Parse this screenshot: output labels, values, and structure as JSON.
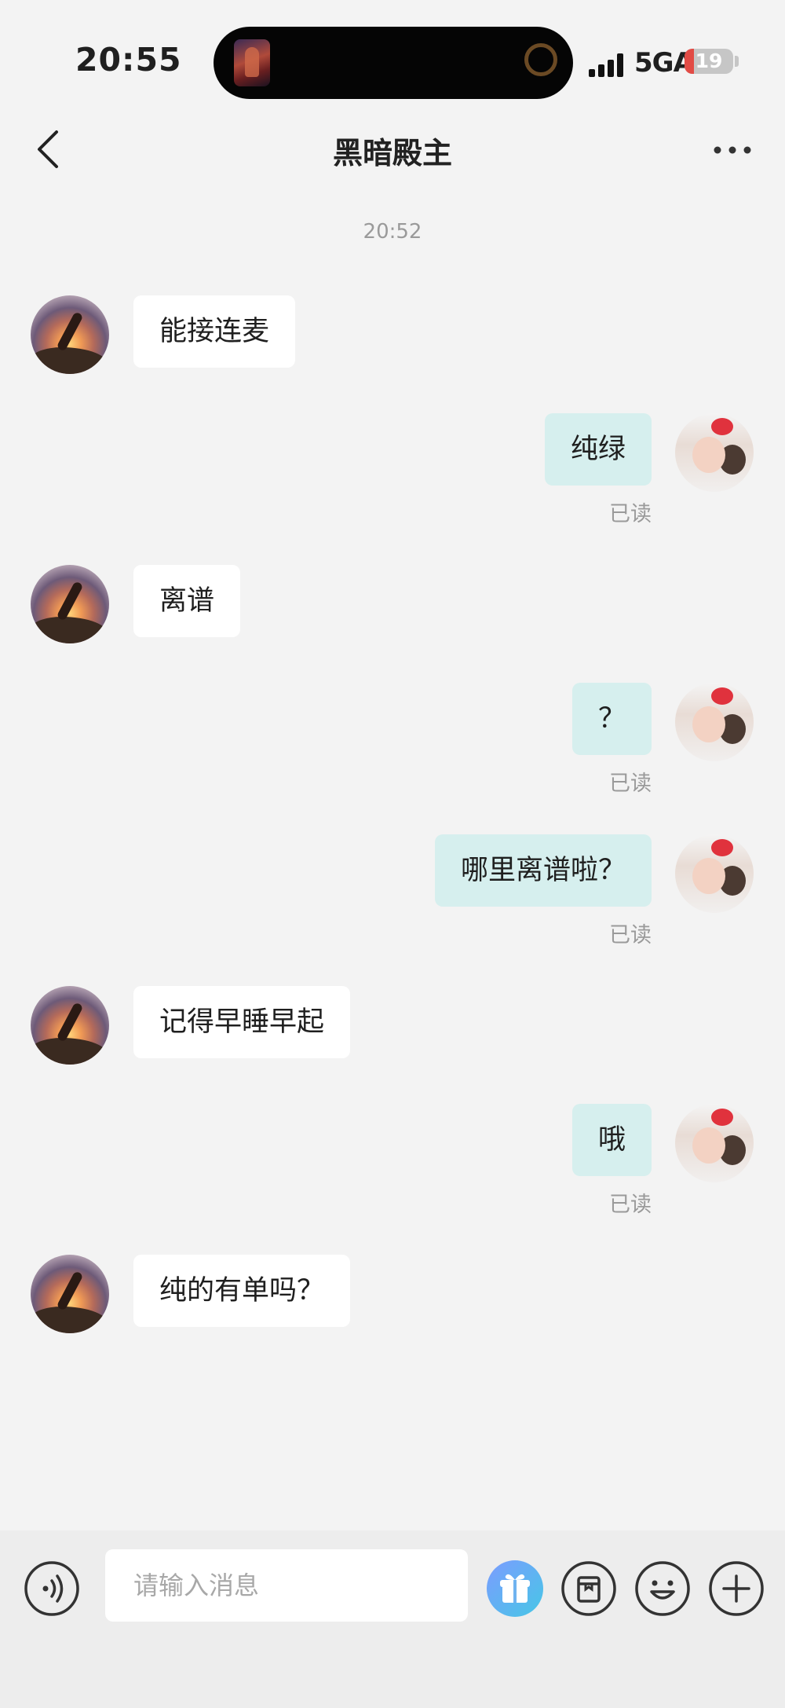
{
  "status_bar": {
    "time": "20:55",
    "network": "5GA",
    "battery": "19",
    "battery_level": 0.19
  },
  "header": {
    "title": "黑暗殿主",
    "back_icon": "chevron-left-icon",
    "more_icon": "more-horizontal-icon"
  },
  "chat": {
    "timestamp": "20:52",
    "messages": [
      {
        "from": "other",
        "text": "能接连麦"
      },
      {
        "from": "self",
        "text": "纯绿",
        "status": "已读"
      },
      {
        "from": "other",
        "text": "离谱"
      },
      {
        "from": "self",
        "text": "？",
        "status": "已读"
      },
      {
        "from": "self",
        "text": "哪里离谱啦？",
        "status": "已读"
      },
      {
        "from": "other",
        "text": "记得早睡早起"
      },
      {
        "from": "self",
        "text": "哦",
        "status": "已读"
      },
      {
        "from": "other",
        "text": "纯的有单吗？"
      }
    ]
  },
  "input_bar": {
    "placeholder": "请输入消息",
    "icons": [
      "voice-icon",
      "gift-icon",
      "box-icon",
      "emoji-icon",
      "plus-icon"
    ]
  },
  "colors": {
    "background": "#f3f3f3",
    "self_bubble": "#d6efee",
    "other_bubble": "#ffffff",
    "battery_low": "#e24b45"
  }
}
